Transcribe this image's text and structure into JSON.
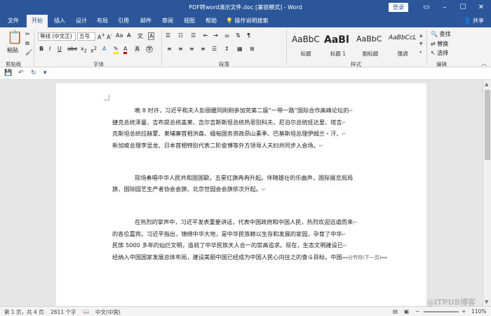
{
  "window": {
    "title": "PDF转word演示文件.doc [兼容模式] - Word",
    "login": "登录",
    "controls": [
      "–",
      "☐",
      "✕"
    ]
  },
  "tabs": [
    "文件",
    "开始",
    "插入",
    "设计",
    "布局",
    "引用",
    "邮件",
    "审阅",
    "视图",
    "帮助"
  ],
  "tell_me": "操作说明搜索",
  "share": "共享",
  "ribbon": {
    "paste": "粘贴",
    "font_name": "等线 (中文正)",
    "font_size": "五号",
    "styles": [
      {
        "sample": "AaBbC",
        "name": "标题"
      },
      {
        "sample": "AaBl",
        "name": "标题 1"
      },
      {
        "sample": "AaBbC",
        "name": "副标题"
      },
      {
        "sample": "AaBbCcL",
        "name": "强调"
      }
    ],
    "find": "查找",
    "replace": "替换",
    "select": "选择",
    "groups": {
      "clipboard": "剪贴板",
      "font": "字体",
      "paragraph": "段落",
      "styles": "样式",
      "editing": "编辑"
    }
  },
  "document": {
    "paragraphs": [
      {
        "lines": [
          "晚 8 时许，习近平和夫人彭丽媛同刚刚参加完第二届“一带一路”国际合作高峰论坛的",
          "捷克总统泽曼、吉布提总统盖莱、吉尔吉斯斯坦总统热恩别科夫、尼泊尔总统班达里、塔吉",
          "克斯坦总统拉赫蒙、柬埔寨首相洪森、缅甸国务资政昂山素季、巴基斯坦总理伊姆兰・汗、",
          "新加坡总理李显龙、日本首相特别代表二阶俊博等外方领导人夫妇共同步入会场。"
        ]
      },
      {
        "lines": [
          "现场奏唱中华人民共和国国歌，五星红旗冉冉升起。伴随雄壮的乐曲声，国际展览局局",
          "旗、国际园艺生产者协会会旗、北京世园会会旗依次升起。"
        ]
      },
      {
        "lines": [
          "在热烈的掌声中，习近平发表重要讲话，代表中国政府和中国人民，热烈欢迎远道而来",
          "的各位嘉宾。习近平指出，锦绣中华大地，是中华民族赖以生存和发展的家园，孕育了中华",
          "民族 5000 多年的灿烂文明，造就了中华民族天人合一的崇高追求。现在，生态文明建设已",
          "经纳入中国国家发展总体布局，建设美丽中国已经成为中国人民心向往之的奋斗目标。中国"
        ]
      }
    ],
    "section_break": "分节符(下一页)"
  },
  "status": {
    "page": "第 1 页，共 4 页",
    "words": "2611 个字",
    "language": "中文(中国)",
    "zoom": "110%"
  },
  "watermark": "@ITPUB博客",
  "colors": {
    "accent": "#2b579a"
  }
}
